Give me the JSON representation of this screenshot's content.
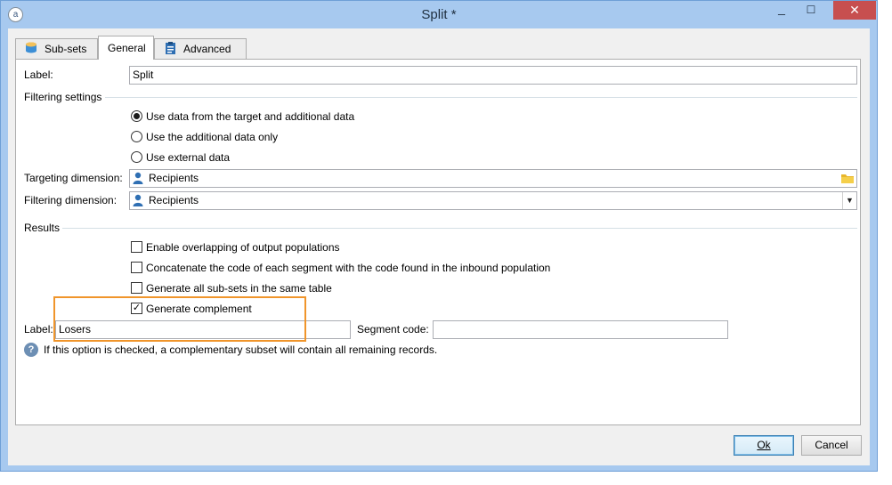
{
  "window": {
    "title": "Split *",
    "app_icon_glyph": "a",
    "minimize_glyph": "_",
    "maximize_glyph": "☐",
    "close_glyph": "✕",
    "accent_color": "#a7c9ef",
    "close_color": "#c74f4f"
  },
  "tabs": [
    {
      "label": "Sub-sets",
      "icon": "database-icon",
      "active": false
    },
    {
      "label": "General",
      "icon": "",
      "active": true
    },
    {
      "label": "Advanced",
      "icon": "clipboard-icon",
      "active": false
    }
  ],
  "general": {
    "label_caption": "Label:",
    "label_value": "Split",
    "filtering_section": "Filtering settings",
    "radios": [
      {
        "label": "Use data from the target and additional data",
        "checked": true
      },
      {
        "label": "Use the additional data only",
        "checked": false
      },
      {
        "label": "Use external data",
        "checked": false
      }
    ],
    "targeting_caption": "Targeting dimension:",
    "targeting_value": "Recipients",
    "filtering_caption": "Filtering dimension:",
    "filtering_value": "Recipients",
    "dropdown_glyph": "▼",
    "results_section": "Results",
    "checkboxes": [
      {
        "label": "Enable overlapping of output populations",
        "checked": false
      },
      {
        "label": "Concatenate the code of each segment with the code found in the inbound population",
        "checked": false
      },
      {
        "label": "Generate all sub-sets in the same table",
        "checked": false
      },
      {
        "label": "Generate complement",
        "checked": true
      }
    ],
    "check_glyph": "✓",
    "complement_label_caption": "Label:",
    "complement_label_value": "Losers",
    "segment_code_caption": "Segment code:",
    "segment_code_value": "",
    "info_glyph": "?",
    "info_text": "If this option is checked, a complementary subset will contain all remaining records.",
    "highlight_color": "#f0952b"
  },
  "buttons": {
    "ok": "Ok",
    "cancel": "Cancel"
  }
}
